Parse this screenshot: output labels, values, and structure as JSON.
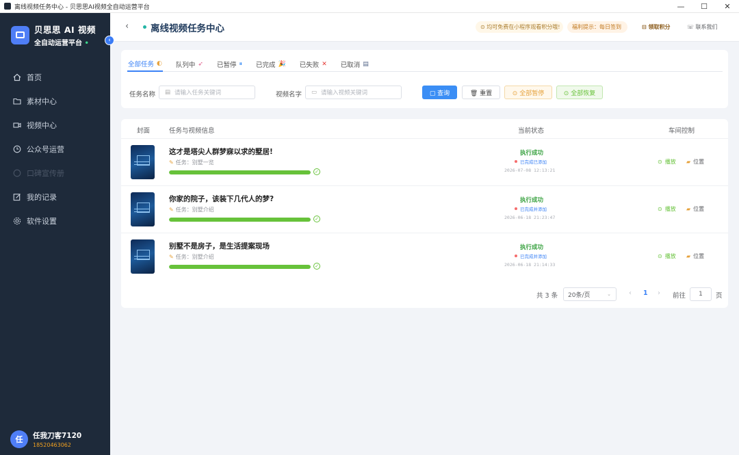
{
  "window": {
    "title": "离线视频任务中心 - 贝思思AI视频全自动运营平台",
    "minimize": "—",
    "maximize": "☐",
    "close": "✕"
  },
  "sidebar": {
    "brand_name": "贝思思 AI 视频",
    "brand_sub": "全自动运营平台",
    "brand_sub_dot": "•",
    "collapse": "‹",
    "items": [
      {
        "label": "首页",
        "icon": "home-icon"
      },
      {
        "label": "素材中心",
        "icon": "folder-icon"
      },
      {
        "label": "视频中心",
        "icon": "video-icon"
      },
      {
        "label": "公众号运营",
        "icon": "clock-icon"
      },
      {
        "label": "口碑宣传册",
        "icon": "shield-icon"
      },
      {
        "label": "我的记录",
        "icon": "edit-icon"
      },
      {
        "label": "软件设置",
        "icon": "gear-icon"
      }
    ],
    "user": {
      "avatar": "任",
      "name": "任我刀客7120",
      "id": "18520463062"
    }
  },
  "header": {
    "back": "‹",
    "title": "离线视频任务中心",
    "notice1": "⊙ 均可免费在小程序观看积分哦!",
    "notice2": "福利提示：每日签到",
    "notice3": "⊟ 领取积分",
    "notice4": "☏ 联系我们"
  },
  "tabs": [
    {
      "label": "全部任务",
      "icon": "◐",
      "active": true
    },
    {
      "label": "队列中",
      "icon": "➶",
      "active": false
    },
    {
      "label": "已暂停",
      "icon": "⏸",
      "active": false
    },
    {
      "label": "已完成",
      "icon": "🎉",
      "active": false
    },
    {
      "label": "已失败",
      "icon": "✕",
      "active": false
    },
    {
      "label": "已取消",
      "icon": "▤",
      "active": false
    }
  ],
  "filters": {
    "task_label": "任务名称",
    "task_placeholder": "请输入任务关键词",
    "video_label": "视频名字",
    "video_placeholder": "请输入视频关键词",
    "query": "▢ 查询",
    "reset": "🗑 重置",
    "pause_all": "⊙ 全部暂停",
    "resume_all": "⊙ 全部恢复"
  },
  "table": {
    "headers": {
      "cover": "封面",
      "info": "任务与视频信息",
      "status": "当前状态",
      "control": "车间控制"
    },
    "rows": [
      {
        "title": "这才是塔尖人群梦寐以求的墅居!",
        "task": "任务：别墅一览",
        "progress": 1.0,
        "status": "执行成功",
        "badge": "已完成已添加",
        "time": "2026-07-08 12:13:21",
        "play": "播放",
        "locate": "位置"
      },
      {
        "title": "你家的院子，该装下几代人的梦?",
        "task": "任务：别墅介绍",
        "progress": 1.0,
        "status": "执行成功",
        "badge": "已完成并添加",
        "time": "2026-06-18 21:23:47",
        "play": "播放",
        "locate": "位置"
      },
      {
        "title": "别墅不是房子，是生活提案现场",
        "task": "任务：别墅介绍",
        "progress": 1.0,
        "status": "执行成功",
        "badge": "已完成并添加",
        "time": "2026-06-18 21:14:33",
        "play": "播放",
        "locate": "位置"
      }
    ]
  },
  "pagination": {
    "total": "共 3 条",
    "page_size": "20条/页",
    "prev": "‹",
    "current": "1",
    "next": "›",
    "goto_label": "前往",
    "goto_value": "1",
    "page_unit": "页"
  },
  "colors": {
    "sidebar": "#1e2a3a",
    "accent": "#3b82f6",
    "success": "#67c23a",
    "warning": "#e6a23c"
  }
}
